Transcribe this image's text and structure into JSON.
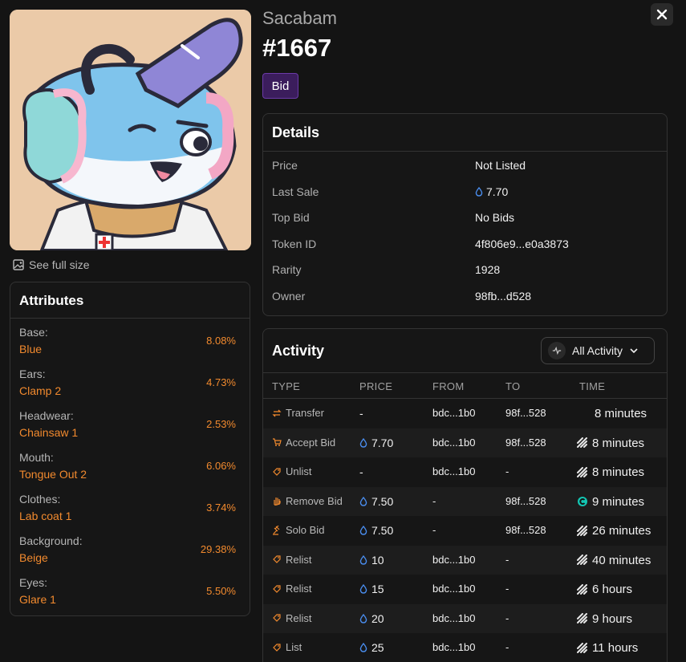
{
  "collection": "Sacabam",
  "token_title": "#1667",
  "bid_label": "Bid",
  "see_full_size": "See full size",
  "attributes": {
    "title": "Attributes",
    "items": [
      {
        "key": "Base:",
        "value": "Blue",
        "pct": "8.08%"
      },
      {
        "key": "Ears:",
        "value": "Clamp 2",
        "pct": "4.73%"
      },
      {
        "key": "Headwear:",
        "value": "Chainsaw 1",
        "pct": "2.53%"
      },
      {
        "key": "Mouth:",
        "value": "Tongue Out 2",
        "pct": "6.06%"
      },
      {
        "key": "Clothes:",
        "value": "Lab coat 1",
        "pct": "3.74%"
      },
      {
        "key": "Background:",
        "value": "Beige",
        "pct": "29.38%"
      },
      {
        "key": "Eyes:",
        "value": "Glare 1",
        "pct": "5.50%"
      }
    ]
  },
  "details": {
    "title": "Details",
    "rows": [
      {
        "key": "Price",
        "value": "Not Listed"
      },
      {
        "key": "Last Sale",
        "value": "7.70",
        "icon": "eth-drop-icon"
      },
      {
        "key": "Top Bid",
        "value": "No Bids"
      },
      {
        "key": "Token ID",
        "value": "4f806e9...e0a3873"
      },
      {
        "key": "Rarity",
        "value": "1928"
      },
      {
        "key": "Owner",
        "value": "98fb...d528"
      }
    ]
  },
  "activity": {
    "title": "Activity",
    "filter_label": "All Activity",
    "columns": [
      "TYPE",
      "PRICE",
      "FROM",
      "TO",
      "TIME"
    ],
    "rows": [
      {
        "type": "Transfer",
        "type_icon": "transfer-icon",
        "price": "-",
        "from": "bdc...1b0",
        "to": "98f...528",
        "time": "8 minutes",
        "market_icon": "none"
      },
      {
        "type": "Accept Bid",
        "type_icon": "cart-icon",
        "price": "7.70",
        "from": "bdc...1b0",
        "to": "98f...528",
        "time": "8 minutes",
        "market_icon": "marketplace-icon"
      },
      {
        "type": "Unlist",
        "type_icon": "tag-icon",
        "price": "-",
        "from": "bdc...1b0",
        "to": "-",
        "time": "8 minutes",
        "market_icon": "marketplace-icon"
      },
      {
        "type": "Remove Bid",
        "type_icon": "hand-icon",
        "price": "7.50",
        "from": "-",
        "to": "98f...528",
        "time": "9 minutes",
        "market_icon": "c-logo-icon"
      },
      {
        "type": "Solo Bid",
        "type_icon": "gavel-icon",
        "price": "7.50",
        "from": "-",
        "to": "98f...528",
        "time": "26 minutes",
        "market_icon": "marketplace-icon"
      },
      {
        "type": "Relist",
        "type_icon": "tag-icon",
        "price": "10",
        "from": "bdc...1b0",
        "to": "-",
        "time": "40 minutes",
        "market_icon": "marketplace-icon"
      },
      {
        "type": "Relist",
        "type_icon": "tag-icon",
        "price": "15",
        "from": "bdc...1b0",
        "to": "-",
        "time": "6 hours",
        "market_icon": "marketplace-icon"
      },
      {
        "type": "Relist",
        "type_icon": "tag-icon",
        "price": "20",
        "from": "bdc...1b0",
        "to": "-",
        "time": "9 hours",
        "market_icon": "marketplace-icon"
      },
      {
        "type": "List",
        "type_icon": "tag-icon",
        "price": "25",
        "from": "bdc...1b0",
        "to": "-",
        "time": "11 hours",
        "market_icon": "marketplace-icon"
      }
    ]
  },
  "colors": {
    "accent_orange": "#f28a2e",
    "bid_purple": "#3b1d5c",
    "eth_blue": "#4a8ef0",
    "teal_logo": "#13c6b3"
  }
}
